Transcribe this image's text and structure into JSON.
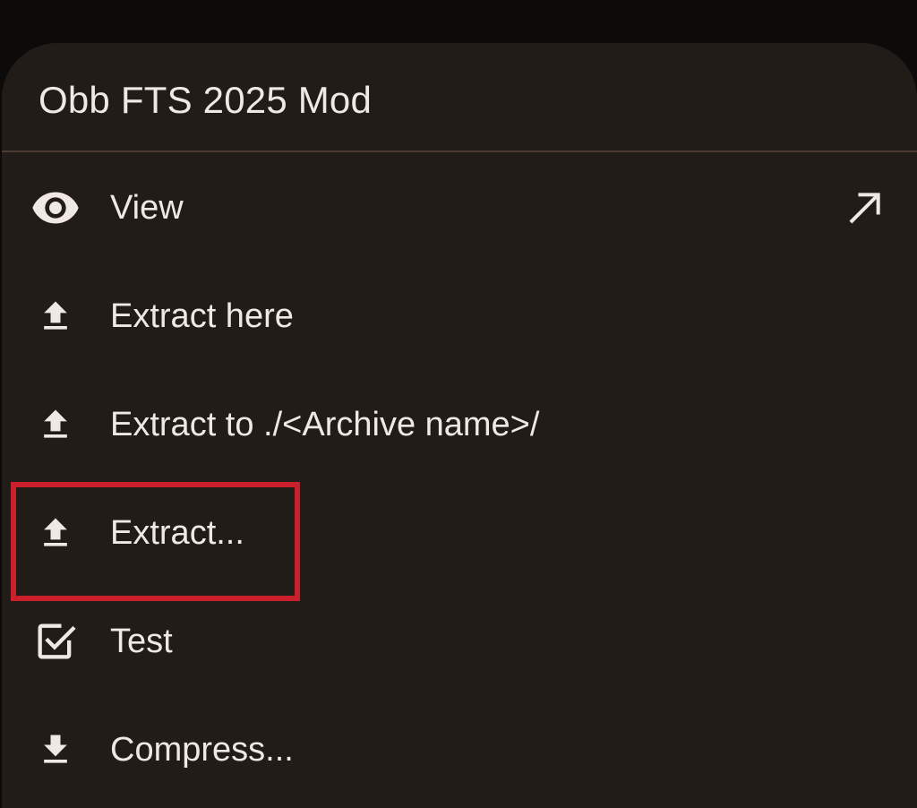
{
  "dialog": {
    "title": "Obb FTS 2025 Mod"
  },
  "menu": {
    "items": [
      {
        "label": "View",
        "icon": "eye-icon",
        "trailing_icon": "open-external-arrow-icon"
      },
      {
        "label": "Extract here",
        "icon": "upload-icon"
      },
      {
        "label": "Extract to ./<Archive name>/",
        "icon": "upload-icon"
      },
      {
        "label": "Extract...",
        "icon": "upload-icon",
        "highlighted": true
      },
      {
        "label": "Test",
        "icon": "checkbox-checked-icon"
      },
      {
        "label": "Compress...",
        "icon": "download-icon"
      }
    ]
  },
  "colors": {
    "background": "#0c0b0a",
    "sheet": "#221c19",
    "text": "#efe8e3",
    "divider": "#4c3d34",
    "highlight": "#cc1f2c"
  }
}
